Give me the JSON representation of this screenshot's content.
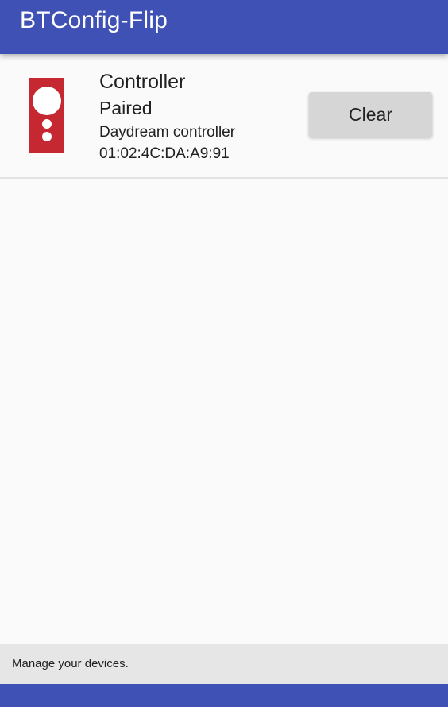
{
  "app": {
    "title": "BTConfig-Flip"
  },
  "device": {
    "name": "Controller",
    "status": "Paired",
    "type": "Daydream controller",
    "address": "01:02:4C:DA:A9:91",
    "icon": "daydream-controller-icon",
    "clear_label": "Clear"
  },
  "footer": {
    "message": "Manage your devices."
  },
  "colors": {
    "primary": "#3f51b5",
    "controller_red": "#c62832",
    "button_gray": "#d6d6d6",
    "background": "#fafafa"
  }
}
